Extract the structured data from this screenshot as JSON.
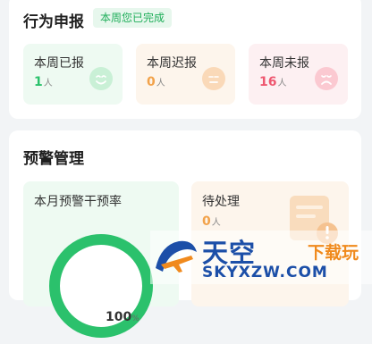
{
  "behavior_report": {
    "title": "行为申报",
    "badge": "本周您已完成",
    "stats": [
      {
        "label": "本周已报",
        "value": "1",
        "unit": "人",
        "color": "#2bc16c"
      },
      {
        "label": "本周迟报",
        "value": "0",
        "unit": "人",
        "color": "#f2a24a"
      },
      {
        "label": "本周未报",
        "value": "16",
        "unit": "人",
        "color": "#ee5870"
      }
    ]
  },
  "warning_management": {
    "title": "预警管理",
    "intervention": {
      "label": "本月预警干预率",
      "value": "100",
      "unit": "%",
      "progress": 1.0
    },
    "pending": {
      "label": "待处理",
      "value": "0",
      "unit": "人"
    }
  },
  "watermark": {
    "name": "天空",
    "tagline": "下载玩",
    "url": "SKYXZW.COM"
  }
}
